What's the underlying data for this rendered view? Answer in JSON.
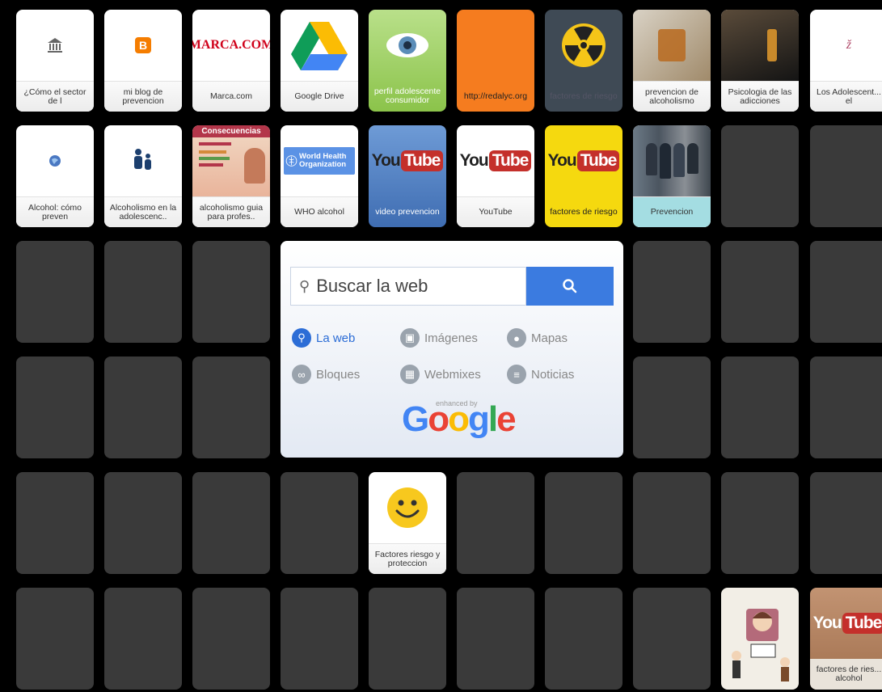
{
  "row1": [
    {
      "label": "¿Cómo el sector de l"
    },
    {
      "label": "mi blog de prevencion"
    },
    {
      "label": "Marca.com",
      "logo_text": "MARCA.COM"
    },
    {
      "label": "Google Drive"
    },
    {
      "label": "perfil adolescente consumidor"
    },
    {
      "label": "http://redalyc.org"
    },
    {
      "label": "factores de riesgo"
    },
    {
      "label": "prevencion de alcoholismo"
    },
    {
      "label": "Psicologia de las adicciones"
    },
    {
      "label": "Los Adolescent... el"
    }
  ],
  "row2": [
    {
      "label": "Alcohol: cómo preven"
    },
    {
      "label": "Alcoholismo en la adolescenc.."
    },
    {
      "label": "alcoholismo guia para profes..",
      "thumb_title": "Consecuencias"
    },
    {
      "label": "WHO alcohol",
      "logo_text": "World Health Organization"
    },
    {
      "label": "video prevencion"
    },
    {
      "label": "YouTube"
    },
    {
      "label": "factores de riesgo"
    },
    {
      "label": "Prevencion"
    }
  ],
  "row5": [
    {
      "label": "Factores riesgo y proteccion"
    }
  ],
  "row6": [
    {
      "label": ""
    },
    {
      "label": "factores de ries... alcohol"
    }
  ],
  "youtube": {
    "you": "You",
    "tube": "Tube"
  },
  "search": {
    "placeholder": "Buscar la web",
    "options": [
      {
        "label": "La web",
        "icon": "search-icon",
        "selected": true
      },
      {
        "label": "Imágenes",
        "icon": "camera-icon"
      },
      {
        "label": "Mapas",
        "icon": "map-pin-icon"
      },
      {
        "label": "Bloques",
        "icon": "link-icon"
      },
      {
        "label": "Webmixes",
        "icon": "webmix-icon"
      },
      {
        "label": "Noticias",
        "icon": "news-icon"
      }
    ],
    "enhanced_by": "enhanced by",
    "brand": "Google"
  },
  "colors": {
    "background": "#000000",
    "empty_tile": "#3a3a3a",
    "search_button": "#3b7be0",
    "youtube_red": "#c4302b"
  }
}
